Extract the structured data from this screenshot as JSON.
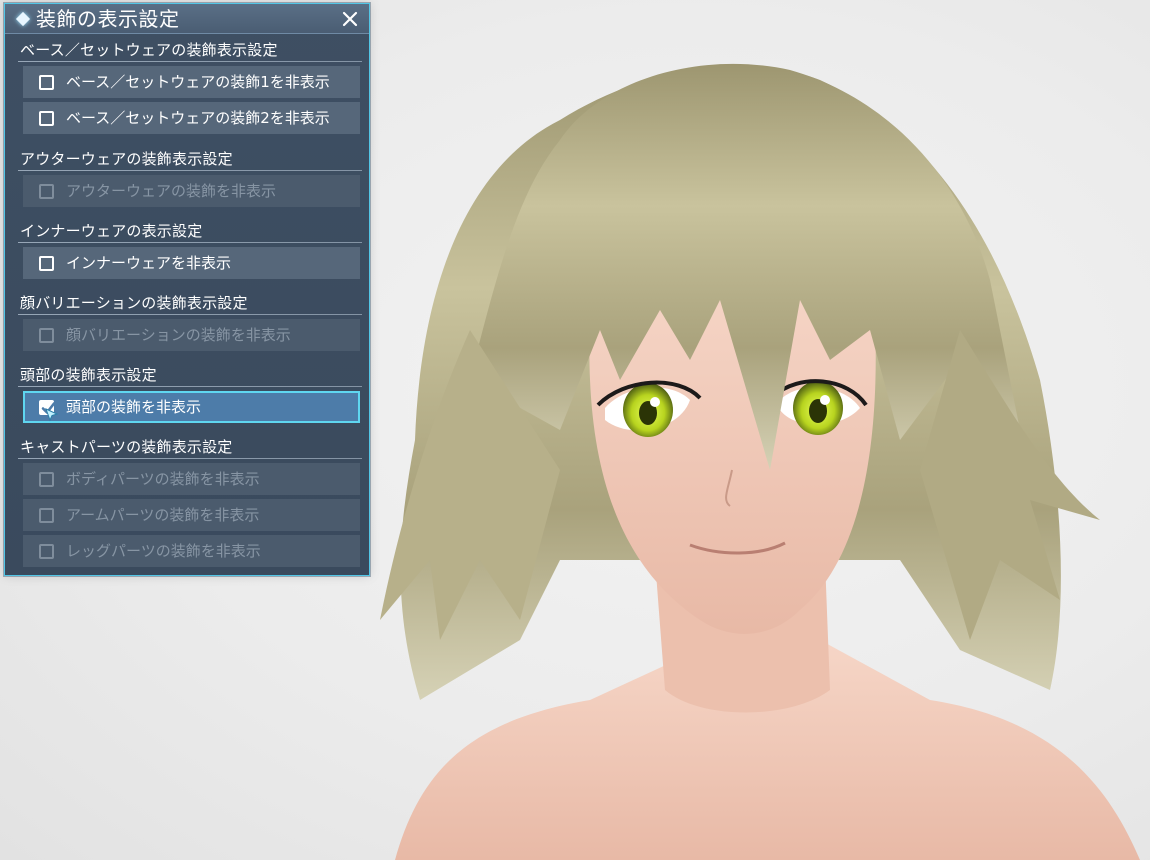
{
  "dialog": {
    "title": "装飾の表示設定",
    "sections": [
      {
        "header": "ベース／セットウェアの装飾表示設定",
        "options": [
          {
            "label": "ベース／セットウェアの装飾1を非表示",
            "checked": false,
            "enabled": true
          },
          {
            "label": "ベース／セットウェアの装飾2を非表示",
            "checked": false,
            "enabled": true
          }
        ]
      },
      {
        "header": "アウターウェアの装飾表示設定",
        "options": [
          {
            "label": "アウターウェアの装飾を非表示",
            "checked": false,
            "enabled": false
          }
        ]
      },
      {
        "header": "インナーウェアの表示設定",
        "options": [
          {
            "label": "インナーウェアを非表示",
            "checked": false,
            "enabled": true
          }
        ]
      },
      {
        "header": "顔バリエーションの装飾表示設定",
        "options": [
          {
            "label": "顔バリエーションの装飾を非表示",
            "checked": false,
            "enabled": false
          }
        ]
      },
      {
        "header": "頭部の装飾表示設定",
        "options": [
          {
            "label": "頭部の装飾を非表示",
            "checked": true,
            "enabled": true,
            "focused": true
          }
        ]
      },
      {
        "header": "キャストパーツの装飾表示設定",
        "options": [
          {
            "label": "ボディパーツの装飾を非表示",
            "checked": false,
            "enabled": false
          },
          {
            "label": "アームパーツの装飾を非表示",
            "checked": false,
            "enabled": false
          },
          {
            "label": "レッグパーツの装飾を非表示",
            "checked": false,
            "enabled": false
          }
        ]
      }
    ]
  },
  "colors": {
    "panel_bg": "#3e4f63",
    "accent_border": "#52c6e6",
    "selected_bg": "#4d7ca9",
    "hair": "#b3ac85",
    "iris": "#b8d41f",
    "skin": "#f0cbb9"
  },
  "icons": {
    "title": "diamond-icon",
    "close": "close-icon",
    "check": "checkmark-icon",
    "pointer": "pointer-cursor-icon"
  }
}
